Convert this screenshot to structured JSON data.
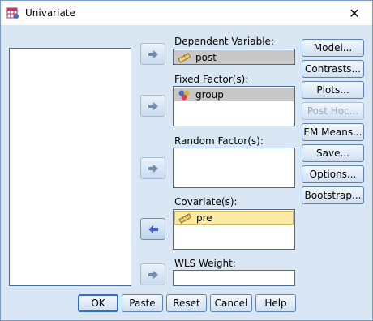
{
  "window": {
    "title": "Univariate",
    "close_glyph": "✕"
  },
  "fields": {
    "dependent": {
      "label": "Dependent Variable:",
      "value": "post",
      "icon": "ruler-scale-icon"
    },
    "fixed": {
      "label": "Fixed Factor(s):",
      "items": [
        "group"
      ],
      "icon": "nominal-circles-icon"
    },
    "random": {
      "label": "Random Factor(s):",
      "items": []
    },
    "covariate": {
      "label": "Covariate(s):",
      "items": [
        "pre"
      ],
      "icon": "ruler-scale-icon"
    },
    "wls": {
      "label": "WLS Weight:",
      "value": ""
    }
  },
  "side_buttons": {
    "model": "Model...",
    "contrasts": "Contrasts...",
    "plots": "Plots...",
    "posthoc": "Post Hoc...",
    "emmeans": "EM Means...",
    "save": "Save...",
    "options": "Options...",
    "bootstrap": "Bootstrap..."
  },
  "bottom_buttons": {
    "ok": "OK",
    "paste": "Paste",
    "reset": "Reset",
    "cancel": "Cancel",
    "help": "Help"
  },
  "colors": {
    "accent": "#2f6fc4",
    "client_bg": "#d9e6f4",
    "highlight_yellow": "#fbe9a6",
    "selected_grey": "#c8c8c8"
  }
}
